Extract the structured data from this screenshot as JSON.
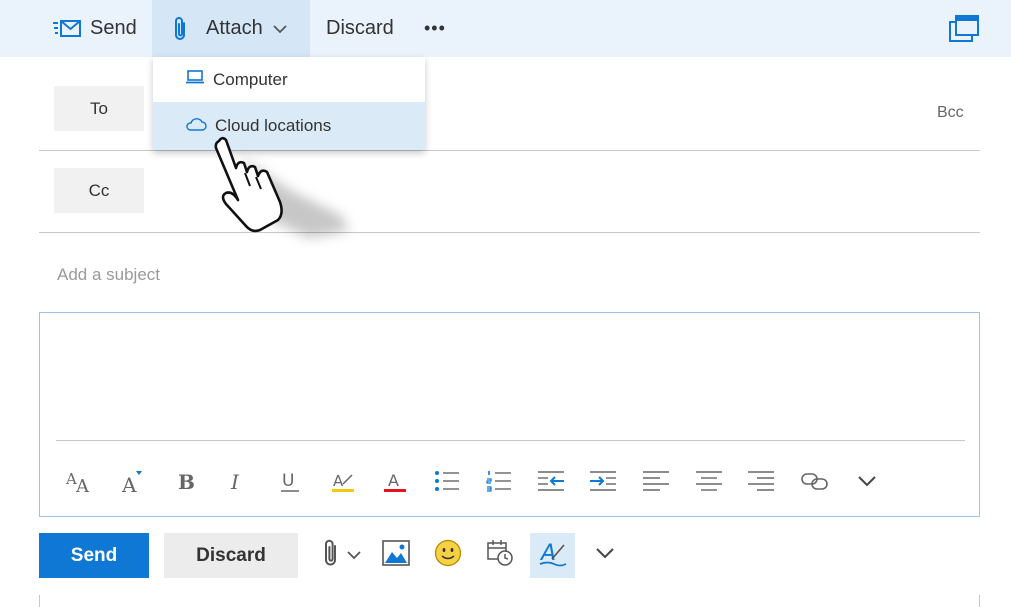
{
  "toolbar": {
    "send_label": "Send",
    "attach_label": "Attach",
    "discard_label": "Discard",
    "more_label": "•••"
  },
  "attach_menu": {
    "items": [
      {
        "label": "Computer",
        "icon": "laptop-icon"
      },
      {
        "label": "Cloud locations",
        "icon": "cloud-icon",
        "highlighted": true
      }
    ]
  },
  "recipients": {
    "to_label": "To",
    "cc_label": "Cc",
    "bcc_label": "Bcc"
  },
  "subject": {
    "placeholder": "Add a subject"
  },
  "format_toolbar": {
    "items": [
      "font-size-icon",
      "grow-font-icon",
      "bold-icon",
      "italic-icon",
      "underline-icon",
      "highlight-icon",
      "font-color-icon",
      "bullets-icon",
      "numbering-icon",
      "decrease-indent-icon",
      "increase-indent-icon",
      "align-left-icon",
      "align-center-icon",
      "align-right-icon",
      "link-icon",
      "chevron-down-icon"
    ],
    "highlight_color": "#f2c811",
    "font_color": "#e81123"
  },
  "actions": {
    "send_label": "Send",
    "discard_label": "Discard"
  },
  "colors": {
    "accent": "#0f78d4",
    "command_bar": "#eaf3fb",
    "menu_highlight": "#dbeaf7"
  }
}
